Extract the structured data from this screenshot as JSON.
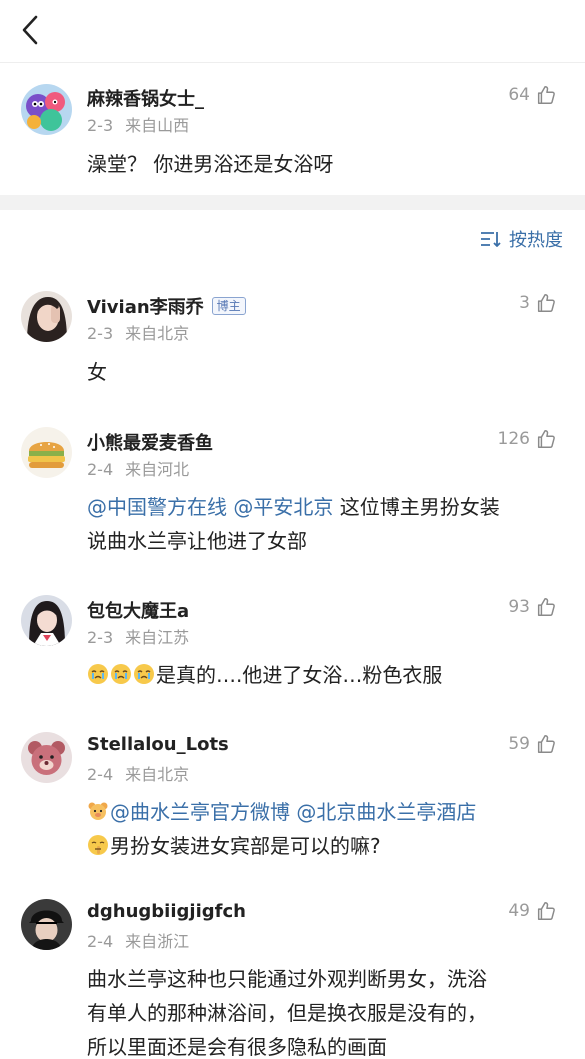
{
  "header": {
    "back_icon": "chevron-left-icon"
  },
  "root": {
    "user": "麻辣香锅女士_",
    "date": "2-3",
    "location": "来自山西",
    "likes": "64",
    "text": "澡堂？ 你进男浴还是女浴呀"
  },
  "sort": {
    "label": "按热度",
    "icon": "sort-icon"
  },
  "replies": [
    {
      "user": "Vivian李雨乔",
      "badge": "博主",
      "date": "2-3",
      "location": "来自北京",
      "likes": "3",
      "text": "女"
    },
    {
      "user": "小熊最爱麦香鱼",
      "date": "2-4",
      "location": "来自河北",
      "likes": "126",
      "mentions": [
        "@中国警方在线",
        "@平安北京"
      ],
      "text_a": " 这位博主男扮女装",
      "text_b": "说曲水兰亭让他进了女部"
    },
    {
      "user": "包包大魔王a",
      "date": "2-3",
      "location": "来自江苏",
      "likes": "93",
      "text": "是真的….他进了女浴…粉色衣服"
    },
    {
      "user": "Stellalou_Lots",
      "date": "2-4",
      "location": "来自北京",
      "likes": "59",
      "mentions": [
        "@曲水兰亭官方微博",
        "@北京曲水兰亭酒店"
      ],
      "text_b": "男扮女装进女宾部是可以的嘛?"
    },
    {
      "user": "dghugbiigjigfch",
      "date": "2-4",
      "location": "来自浙江",
      "likes": "49",
      "lines": [
        "曲水兰亭这种也只能通过外观判断男女，洗浴",
        "有单人的那种淋浴间，但是换衣服是没有的，",
        "所以里面还是会有很多隐私的画面"
      ]
    }
  ],
  "colors": {
    "mention": "#3a6fa8",
    "meta": "#9a9a9a",
    "divider": "#f2f2f2"
  }
}
